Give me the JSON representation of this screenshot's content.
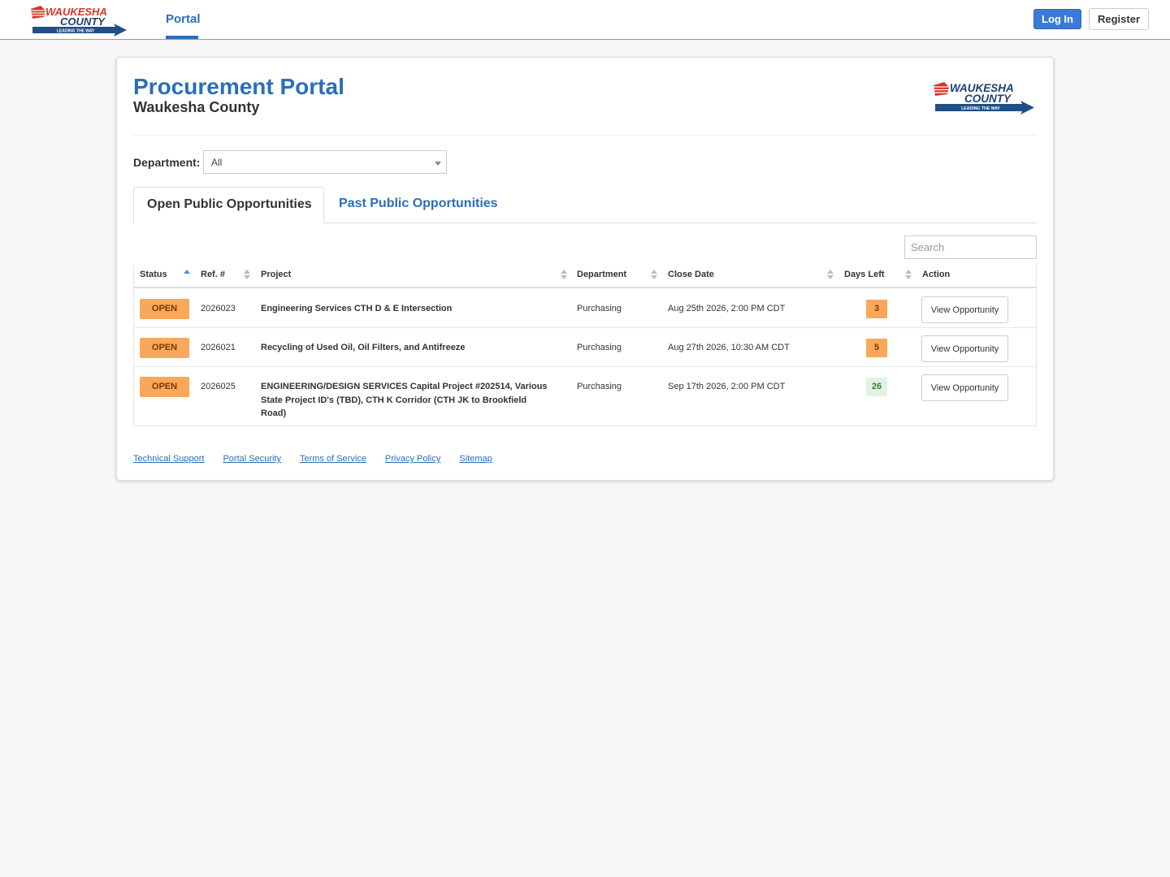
{
  "header": {
    "logo_alt": "Waukesha County - Leading the Way",
    "nav_portal": "Portal",
    "login_label": "Log In",
    "register_label": "Register"
  },
  "colors": {
    "brand_blue": "#2a6ebb",
    "open_orange": "#f9a85b",
    "days_green": "#e3f3e3"
  },
  "page": {
    "title": "Procurement Portal",
    "subtitle": "Waukesha County"
  },
  "filter": {
    "department_label": "Department:",
    "department_value": "All"
  },
  "tabs": {
    "open_label": "Open Public Opportunities",
    "past_label": "Past Public Opportunities"
  },
  "search": {
    "placeholder": "Search"
  },
  "table": {
    "headers": {
      "status": "Status",
      "ref": "Ref. #",
      "project": "Project",
      "department": "Department",
      "close_date": "Close Date",
      "days_left": "Days Left",
      "action": "Action"
    },
    "rows": [
      {
        "status": "OPEN",
        "ref": "2026023",
        "project": "Engineering Services CTH D & E Intersection",
        "department": "Purchasing",
        "close_date": "Aug 25th 2026, 2:00 PM CDT",
        "days_left": "3",
        "days_color": "orange",
        "action": "View Opportunity"
      },
      {
        "status": "OPEN",
        "ref": "2026021",
        "project": "Recycling of Used Oil, Oil Filters, and Antifreeze",
        "department": "Purchasing",
        "close_date": "Aug 27th 2026, 10:30 AM CDT",
        "days_left": "5",
        "days_color": "orange",
        "action": "View Opportunity"
      },
      {
        "status": "OPEN",
        "ref": "2026025",
        "project": "ENGINEERING/DESIGN SERVICES Capital Project #202514, Various State Project ID's (TBD), CTH K Corridor (CTH JK to Brookfield Road)",
        "department": "Purchasing",
        "close_date": "Sep 17th 2026, 2:00 PM CDT",
        "days_left": "26",
        "days_color": "green",
        "action": "View Opportunity"
      }
    ]
  },
  "footer": {
    "links": [
      "Technical Support",
      "Portal Security",
      "Terms of Service",
      "Privacy Policy",
      "Sitemap"
    ]
  }
}
